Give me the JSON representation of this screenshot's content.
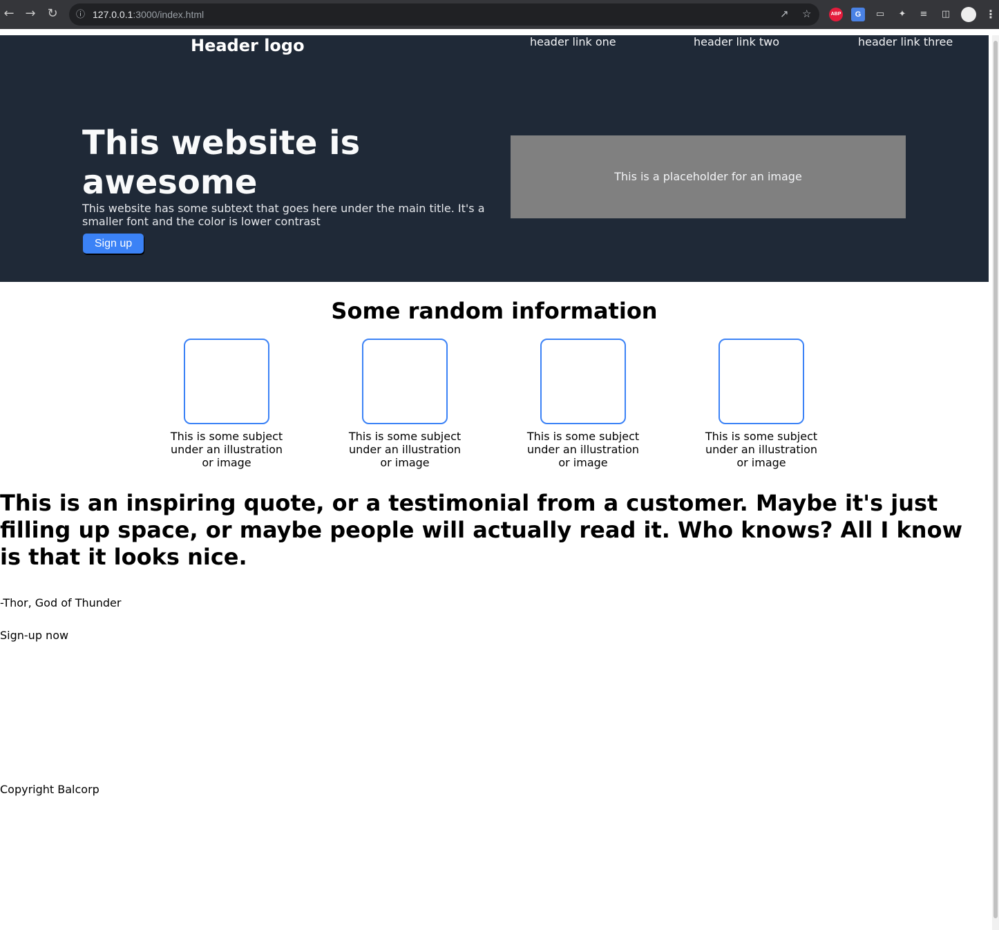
{
  "browser": {
    "url_host": "127.0.0.1",
    "url_rest": ":3000/index.html",
    "back_icon": "arrow-left-icon",
    "forward_icon": "arrow-right-icon",
    "reload_icon": "reload-icon",
    "extensions": [
      "adblock-plus-icon",
      "translate-icon",
      "cast-icon",
      "puzzle-extensions-icon",
      "media-queue-icon",
      "side-panel-icon",
      "profile-avatar-icon",
      "kebab-menu-icon"
    ],
    "abp_label": "ABP",
    "translate_label": "G"
  },
  "header": {
    "logo": "Header logo",
    "links": [
      "header link one",
      "header link two",
      "header link three"
    ]
  },
  "hero": {
    "title": "This website is awesome",
    "subtext": "This website has some subtext that goes here under the main title. It's a smaller font and the color is lower contrast",
    "button": "Sign up",
    "image_placeholder": "This is a placeholder for an image",
    "colors": {
      "background": "#1f2937",
      "button": "#3b82f6",
      "placeholder": "#808080"
    }
  },
  "info": {
    "title": "Some random information",
    "cards": [
      "This is some subject under an illustration or image",
      "This is some subject under an illustration or image",
      "This is some subject under an illustration or image",
      "This is some subject under an illustration or image"
    ]
  },
  "quote": {
    "text": "This is an inspiring quote, or a testimonial from a customer. Maybe it's just filling up space, or maybe people will actually read it. Who knows? All I know is that it looks nice.",
    "attribution": "-Thor, God of Thunder"
  },
  "cta": {
    "text": "Sign-up now"
  },
  "footer": {
    "copyright": "Copyright Balcorp"
  }
}
